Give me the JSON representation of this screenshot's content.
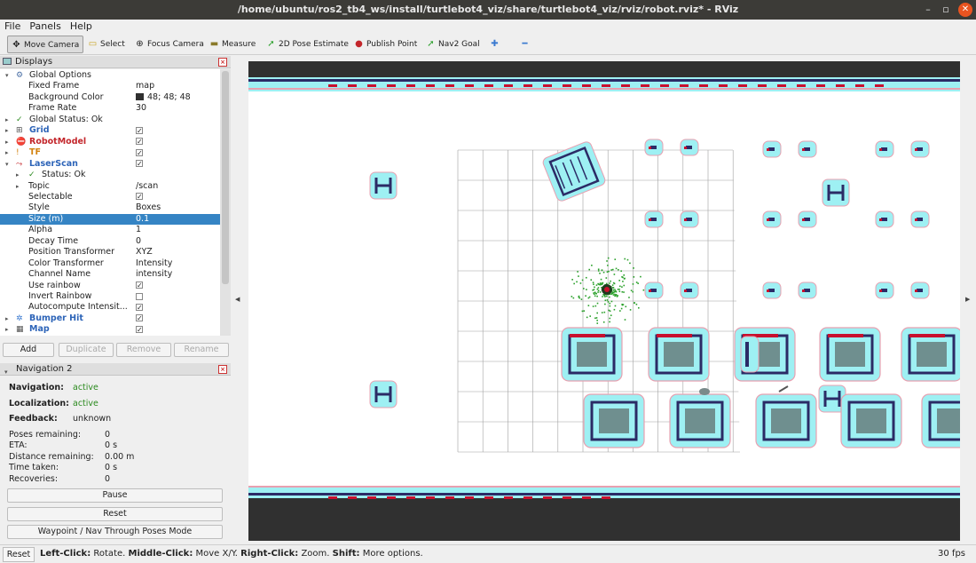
{
  "window": {
    "title": "/home/ubuntu/ros2_tb4_ws/install/turtlebot4_viz/share/turtlebot4_viz/rviz/robot.rviz* - RViz",
    "controls": [
      "–",
      "▫",
      "✕"
    ]
  },
  "menu": [
    "File",
    "Panels",
    "Help"
  ],
  "toolbar": [
    {
      "label": "Move Camera",
      "icon": "move-camera-icon",
      "glyph": "✥"
    },
    {
      "label": "Select",
      "icon": "select-icon",
      "glyph": "▭"
    },
    {
      "label": "Focus Camera",
      "icon": "focus-camera-icon",
      "glyph": "⊕"
    },
    {
      "label": "Measure",
      "icon": "measure-icon",
      "glyph": "▬"
    },
    {
      "label": "2D Pose Estimate",
      "icon": "pose-estimate-icon",
      "glyph": "➚"
    },
    {
      "label": "Publish Point",
      "icon": "publish-point-icon",
      "glyph": "📍"
    },
    {
      "label": "Nav2 Goal",
      "icon": "nav2-goal-icon",
      "glyph": "➚"
    },
    {
      "label": "",
      "icon": "add-tool-icon",
      "glyph": "✚"
    },
    {
      "label": "",
      "icon": "remove-tool-icon",
      "glyph": "━"
    }
  ],
  "displays": {
    "title": "Displays",
    "rows": [
      {
        "key": "Global Options",
        "value": "",
        "style": "",
        "icon": "gear-icon",
        "glyph": "⚙",
        "indent": 1,
        "arrow": "▾"
      },
      {
        "key": "Fixed Frame",
        "value": "map",
        "style": "",
        "indent": 2
      },
      {
        "key": "Background Color",
        "value": "48; 48; 48",
        "style": "",
        "indent": 2,
        "swatch": "#303030"
      },
      {
        "key": "Frame Rate",
        "value": "30",
        "style": "",
        "indent": 2
      },
      {
        "key": "Global Status: Ok",
        "value": "",
        "style": "",
        "icon": "check-icon",
        "glyph": "✓",
        "indent": 1,
        "arrow": "▸"
      },
      {
        "key": "Grid",
        "value": "",
        "style": "blue",
        "icon": "grid-icon",
        "glyph": "⊞",
        "indent": 1,
        "arrow": "▸",
        "check": "✓"
      },
      {
        "key": "RobotModel",
        "value": "",
        "style": "red",
        "icon": "robot-model-error-icon",
        "glyph": "⛔",
        "indent": 1,
        "arrow": "▸",
        "check": "✓"
      },
      {
        "key": "TF",
        "value": "",
        "style": "orange",
        "icon": "tf-warning-icon",
        "glyph": "!",
        "indent": 1,
        "arrow": "▸",
        "check": "✓"
      },
      {
        "key": "LaserScan",
        "value": "",
        "style": "blue",
        "icon": "laserscan-icon",
        "glyph": "⤳",
        "indent": 1,
        "arrow": "▾",
        "check": "✓"
      },
      {
        "key": "Status: Ok",
        "value": "",
        "style": "",
        "icon": "check-icon",
        "glyph": "✓",
        "indent": 2,
        "arrow": "▸"
      },
      {
        "key": "Topic",
        "value": "/scan",
        "style": "",
        "indent": 2,
        "arrow": "▸"
      },
      {
        "key": "Selectable",
        "value": "",
        "style": "",
        "indent": 2,
        "check": "✓"
      },
      {
        "key": "Style",
        "value": "Boxes",
        "style": "",
        "indent": 2
      },
      {
        "key": "Size (m)",
        "value": "0.1",
        "style": "sel",
        "indent": 2
      },
      {
        "key": "Alpha",
        "value": "1",
        "style": "",
        "indent": 2
      },
      {
        "key": "Decay Time",
        "value": "0",
        "style": "",
        "indent": 2
      },
      {
        "key": "Position Transformer",
        "value": "XYZ",
        "style": "",
        "indent": 2
      },
      {
        "key": "Color Transformer",
        "value": "Intensity",
        "style": "",
        "indent": 2
      },
      {
        "key": "Channel Name",
        "value": "intensity",
        "style": "",
        "indent": 2
      },
      {
        "key": "Use rainbow",
        "value": "",
        "style": "",
        "indent": 2,
        "check": "✓"
      },
      {
        "key": "Invert Rainbow",
        "value": "",
        "style": "",
        "indent": 2,
        "check": " "
      },
      {
        "key": "Autocompute Intensit...",
        "value": "",
        "style": "",
        "indent": 2,
        "check": "✓"
      },
      {
        "key": "Bumper Hit",
        "value": "",
        "style": "blue",
        "icon": "bumper-hit-icon",
        "glyph": "✲",
        "indent": 1,
        "arrow": "▸",
        "check": "✓"
      },
      {
        "key": "Map",
        "value": "",
        "style": "blue",
        "icon": "map-icon",
        "glyph": "▦",
        "indent": 1,
        "arrow": "▸",
        "check": "✓"
      }
    ],
    "buttons": [
      {
        "label": "Add",
        "enabled": true
      },
      {
        "label": "Duplicate",
        "enabled": false
      },
      {
        "label": "Remove",
        "enabled": false
      },
      {
        "label": "Rename",
        "enabled": false
      }
    ]
  },
  "navigation": {
    "title": "Navigation 2",
    "status": [
      {
        "key": "Navigation:",
        "value": "active",
        "color": "green"
      },
      {
        "key": "Localization:",
        "value": "active",
        "color": "green"
      },
      {
        "key": "Feedback:",
        "value": "unknown",
        "color": ""
      }
    ],
    "stats": [
      {
        "key": "Poses remaining:",
        "value": "0"
      },
      {
        "key": "ETA:",
        "value": "0 s"
      },
      {
        "key": "Distance remaining:",
        "value": "0.00 m"
      },
      {
        "key": "Time taken:",
        "value": "0 s"
      },
      {
        "key": "Recoveries:",
        "value": "0"
      }
    ],
    "buttons": [
      "Pause",
      "Reset",
      "Waypoint / Nav Through Poses Mode"
    ]
  },
  "statusbar": {
    "reset": "Reset",
    "segments": [
      {
        "text": "Left-Click:",
        "bold": true
      },
      {
        "text": " Rotate. ",
        "bold": false
      },
      {
        "text": "Middle-Click:",
        "bold": true
      },
      {
        "text": " Move X/Y. ",
        "bold": false
      },
      {
        "text": "Right-Click:",
        "bold": true
      },
      {
        "text": " Zoom. ",
        "bold": false
      },
      {
        "text": "Shift:",
        "bold": true
      },
      {
        "text": " More options.",
        "bold": false
      }
    ],
    "fps": "30 fps"
  },
  "colors": {
    "map_free": "#ffffff",
    "map_unknown": "#303030",
    "inflation": "#9ef0f3",
    "costmap_edge": "#e8a0b0",
    "obstacle": "#2b2b66",
    "laser": "#c8102e",
    "particles": "#2aa02a",
    "grid": "#a0a0a0",
    "accent_selected": "#3584c4"
  }
}
